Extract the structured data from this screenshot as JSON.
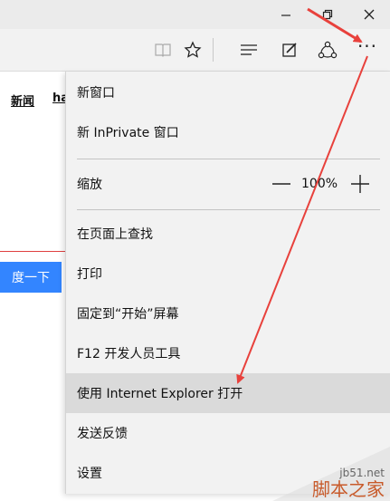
{
  "page": {
    "nav_links": [
      "新闻",
      "ha"
    ],
    "search_button": "度一下"
  },
  "menu": {
    "items": {
      "new_window": "新窗口",
      "new_inprivate": "新 InPrivate 窗口",
      "zoom": "缩放",
      "find_on_page": "在页面上查找",
      "print": "打印",
      "pin_to_start": "固定到“开始”屏幕",
      "f12_tools": "F12 开发人员工具",
      "open_with_ie": "使用 Internet Explorer 打开",
      "send_feedback": "发送反馈",
      "settings": "设置"
    },
    "zoom_level": "100%"
  },
  "watermark": {
    "site": "jb51.net",
    "name": "脚本之家"
  },
  "colors": {
    "accent": "#3385ff",
    "arrow": "#e8413c",
    "highlight": "#dadada"
  }
}
